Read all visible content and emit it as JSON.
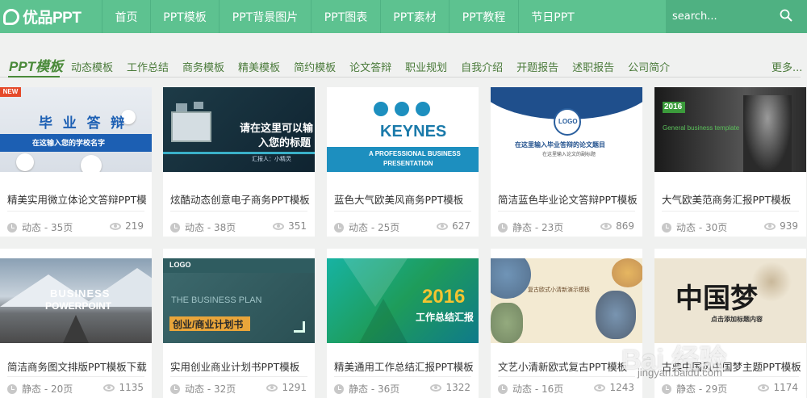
{
  "header": {
    "logo_text": "优品PPT",
    "nav": [
      "首页",
      "PPT模板",
      "PPT背景图片",
      "PPT图表",
      "PPT素材",
      "PPT教程",
      "节日PPT"
    ],
    "search_placeholder": "search..."
  },
  "category": {
    "title": "PPT模板",
    "links": [
      "动态模板",
      "工作总结",
      "商务模板",
      "精美模板",
      "简约模板",
      "论文答辩",
      "职业规划",
      "自我介绍",
      "开题报告",
      "述职报告",
      "公司简介"
    ],
    "more": "更多..."
  },
  "cards": [
    {
      "title": "精美实用微立体论文答辩PPT模",
      "type": "动态",
      "pages": "35页",
      "meta": "动态 - 35页",
      "views": "219",
      "badge": "NEW",
      "thumb": {
        "line1": "毕 业 答 辩",
        "line2": "在这输入您的学校名字"
      }
    },
    {
      "title": "炫酷动态创意电子商务PPT模板",
      "type": "动态",
      "pages": "38页",
      "meta": "动态 - 38页",
      "views": "351",
      "thumb": {
        "line1": "请在这里可以输",
        "line2": "入您的标题",
        "line3": "汇报人：小精灵"
      }
    },
    {
      "title": "蓝色大气欧美风商务PPT模板",
      "type": "动态",
      "pages": "25页",
      "meta": "动态 - 25页",
      "views": "627",
      "thumb": {
        "line1": "KEYNES",
        "line2": "A PROFESSIONAL BUSINESS",
        "line3": "PRESENTATION"
      }
    },
    {
      "title": "简洁蓝色毕业论文答辩PPT模板",
      "type": "静态",
      "pages": "23页",
      "meta": "静态 - 23页",
      "views": "869",
      "thumb": {
        "line1": "LOGO",
        "line2": "在这里输入毕业答辩的论文题目",
        "line3": "在这里输入论文的副标题"
      }
    },
    {
      "title": "大气欧美范商务汇报PPT模板",
      "type": "动态",
      "pages": "30页",
      "meta": "动态 - 30页",
      "views": "939",
      "thumb": {
        "line1": "2016",
        "line2": "General business template"
      }
    },
    {
      "title": "简洁商务图文排版PPT模板下载",
      "type": "静态",
      "pages": "20页",
      "meta": "静态 - 20页",
      "views": "1135",
      "thumb": {
        "line1": "BUSINESS",
        "line2": "POWERPOINT"
      }
    },
    {
      "title": "实用创业商业计划书PPT模板",
      "type": "动态",
      "pages": "32页",
      "meta": "动态 - 32页",
      "views": "1291",
      "thumb": {
        "line1": "LOGO",
        "line2": "THE BUSINESS PLAN",
        "line3": "创业/商业计划书"
      }
    },
    {
      "title": "精美通用工作总结汇报PPT模板",
      "type": "静态",
      "pages": "36页",
      "meta": "静态 - 36页",
      "views": "1322",
      "thumb": {
        "line1": "2016",
        "line2": "工作总结汇报"
      }
    },
    {
      "title": "文艺小清新欧式复古PPT模板",
      "type": "动态",
      "pages": "16页",
      "meta": "动态 - 16页",
      "views": "1243",
      "thumb": {
        "line1": "复古欧式小清新演示模板"
      }
    },
    {
      "title": "古典中国风中国梦主题PPT模板",
      "type": "静态",
      "pages": "29页",
      "meta": "静态 - 29页",
      "views": "1174",
      "thumb": {
        "line1": "中国梦",
        "line2": "点击添加标题内容"
      }
    }
  ],
  "watermark": {
    "text": "Bai 经验",
    "sub": "jingyan.baidu.com"
  },
  "colors": {
    "nav_bg": "#5dc290",
    "accent": "#4a8a3a"
  }
}
